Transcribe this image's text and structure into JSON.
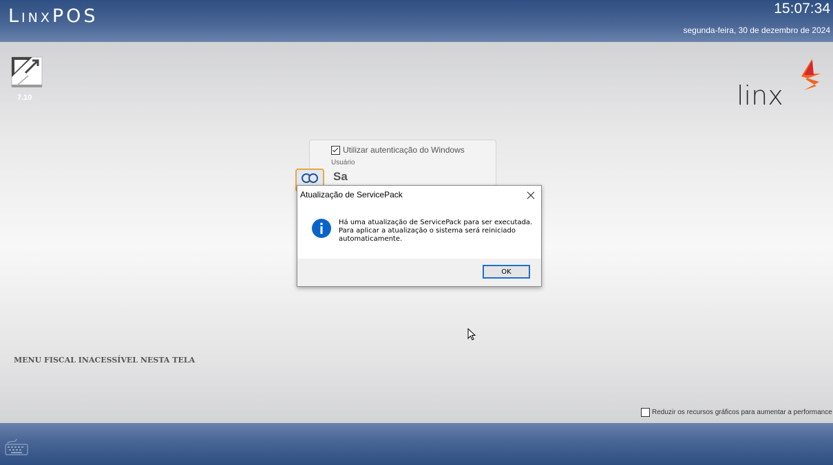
{
  "header": {
    "app_title": "LinxPOS",
    "clock": "15:07:34",
    "date": "segunda-feira, 30 de dezembro de 2024"
  },
  "version": {
    "label": "7.10"
  },
  "login": {
    "windows_auth_label": "Utilizar autenticação do Windows",
    "windows_auth_checked": true,
    "user_label": "Usuário",
    "user_value": "Sa"
  },
  "dialog": {
    "title": "Atualização de ServicePack",
    "message_lines": [
      "Há uma atualização de ServicePack para ser executada.",
      "Para aplicar a atualização o sistema será reiniciado",
      "automaticamente."
    ],
    "ok_label": "OK"
  },
  "fiscal_notice": "MENU FISCAL INACESSÍVEL NESTA TELA",
  "performance_option": {
    "label": "Reduzir os recursos gráficos para aumentar a performance",
    "checked": false
  },
  "colors": {
    "header_blue": "#2f4f82",
    "linx_orange": "#f26522",
    "linx_red": "#d7282f",
    "focus_blue": "#1f6fd1",
    "info_blue": "#0a64c8"
  },
  "icons": [
    "maximize-arrows-icon",
    "linx-logo",
    "users-icon",
    "close-icon",
    "info-icon",
    "keyboard-icon",
    "mouse-cursor"
  ]
}
